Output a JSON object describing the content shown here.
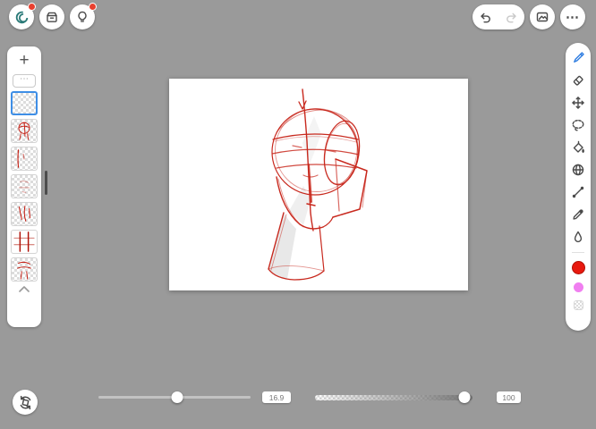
{
  "colors": {
    "background": "#9a9a9a",
    "accent_blue": "#2f7de1",
    "selected_layer_border": "#3e8ee6",
    "brush_red": "#c4170b",
    "swatch_red": "#e8190f",
    "swatch_pink": "#f07ff0",
    "badge_red": "#e8402f"
  },
  "topbar": {
    "left_icons": [
      "app-logo-icon",
      "save-icon",
      "tips-icon"
    ],
    "badges": {
      "app": true,
      "tips": true
    },
    "right_icons": [
      "undo-icon",
      "redo-icon",
      "gallery-icon",
      "menu-icon"
    ],
    "menu_dots": "⋯",
    "undo_enabled": true,
    "redo_enabled": false
  },
  "layers_panel": {
    "add_label": "+",
    "more_label": "⋯",
    "layers": [
      {
        "selected": true,
        "transparent": true,
        "pattern": "empty"
      },
      {
        "selected": false,
        "transparent": true,
        "pattern": "sketch"
      },
      {
        "selected": false,
        "transparent": true,
        "pattern": "vline"
      },
      {
        "selected": false,
        "transparent": true,
        "pattern": "faint"
      },
      {
        "selected": false,
        "transparent": true,
        "pattern": "marks"
      },
      {
        "selected": false,
        "transparent": false,
        "pattern": "grid"
      },
      {
        "selected": false,
        "transparent": true,
        "pattern": "sketch2"
      }
    ]
  },
  "toolbar": {
    "tools": [
      {
        "name": "brush-tool",
        "selected": true
      },
      {
        "name": "eraser-tool",
        "selected": false
      },
      {
        "name": "move-tool",
        "selected": false
      },
      {
        "name": "lasso-tool",
        "selected": false
      },
      {
        "name": "fill-tool",
        "selected": false
      },
      {
        "name": "mesh-tool",
        "selected": false
      },
      {
        "name": "line-tool",
        "selected": false
      },
      {
        "name": "eyedropper-tool",
        "selected": false
      },
      {
        "name": "blend-tool",
        "selected": false
      }
    ],
    "swatches": [
      "#e8190f",
      "#f07ff0",
      "transparent"
    ],
    "selected_color": "#e8190f"
  },
  "sliders": {
    "brush_size": {
      "value": "16.9",
      "percent": 52
    },
    "opacity": {
      "value": "100",
      "percent": 95
    }
  }
}
